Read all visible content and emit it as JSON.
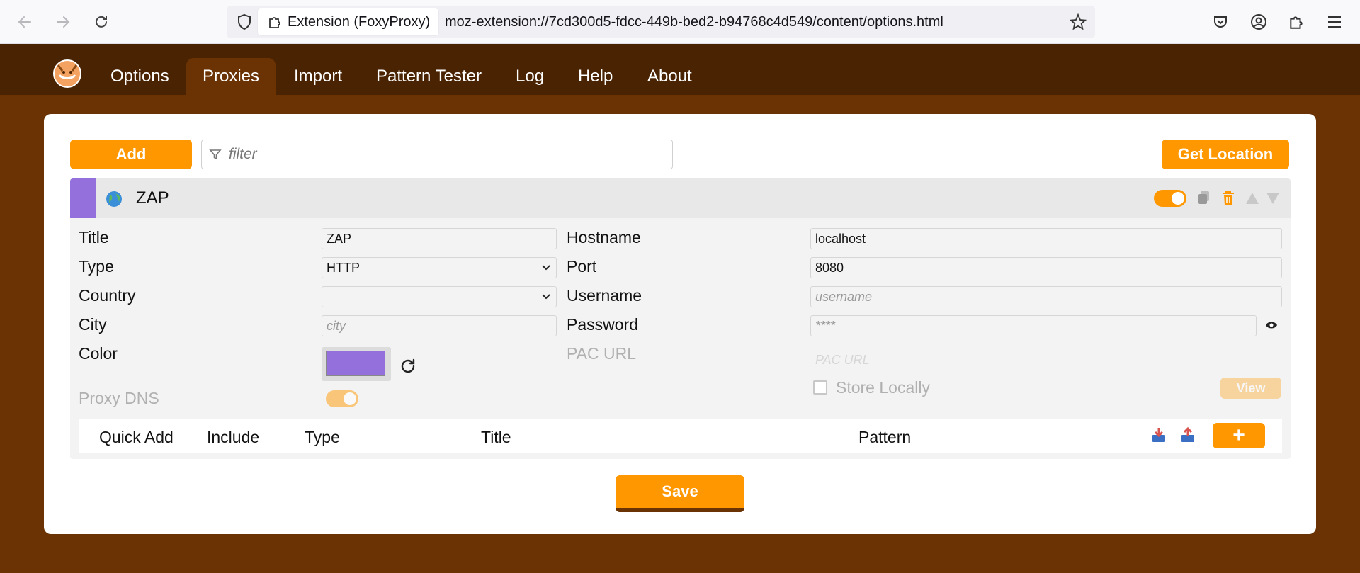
{
  "browser": {
    "extension_label": "Extension (FoxyProxy)",
    "url": "moz-extension://7cd300d5-fdcc-449b-bed2-b94768c4d549/content/options.html"
  },
  "nav": {
    "items": [
      "Options",
      "Proxies",
      "Import",
      "Pattern Tester",
      "Log",
      "Help",
      "About"
    ],
    "active": "Proxies"
  },
  "toolbar": {
    "add_label": "Add",
    "filter_placeholder": "filter",
    "get_location_label": "Get Location"
  },
  "proxy": {
    "name": "ZAP",
    "color": "#9370db",
    "enabled": true,
    "fields": {
      "title_label": "Title",
      "title_value": "ZAP",
      "type_label": "Type",
      "type_value": "HTTP",
      "country_label": "Country",
      "country_value": "",
      "city_label": "City",
      "city_placeholder": "city",
      "color_label": "Color",
      "proxy_dns_label": "Proxy DNS",
      "hostname_label": "Hostname",
      "hostname_value": "localhost",
      "port_label": "Port",
      "port_value": "8080",
      "username_label": "Username",
      "username_placeholder": "username",
      "password_label": "Password",
      "password_placeholder": "****",
      "pac_url_label": "PAC URL",
      "pac_url_placeholder": "PAC URL",
      "store_locally_label": "Store Locally",
      "view_label": "View"
    },
    "patterns_header": {
      "quick_add": "Quick Add",
      "include": "Include",
      "type": "Type",
      "title": "Title",
      "pattern": "Pattern",
      "add_label": "+"
    }
  },
  "save_label": "Save",
  "colors": {
    "brand_brown": "#6b3304",
    "nav_brown": "#4a2303",
    "accent_orange": "#ff9800",
    "proxy_color": "#9370db"
  }
}
